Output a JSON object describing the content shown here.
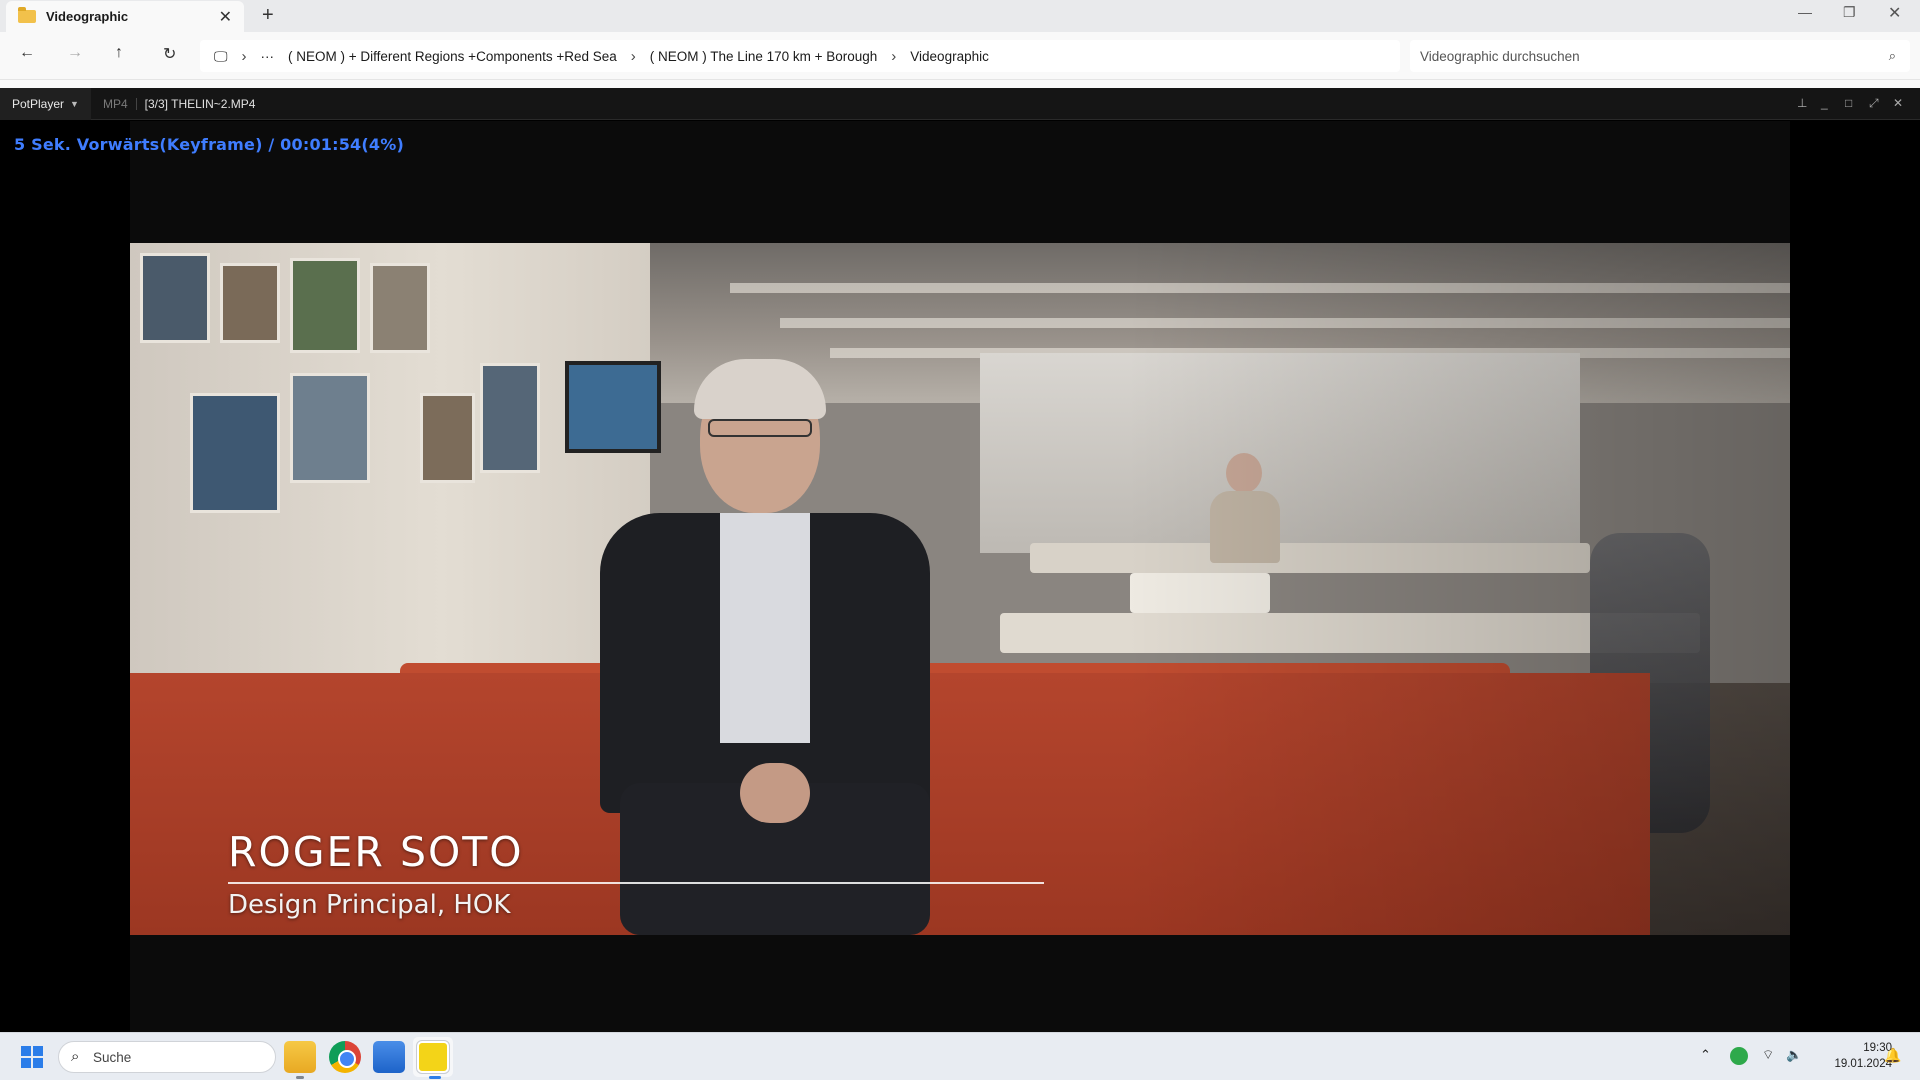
{
  "explorer": {
    "tab_title": "Videographic",
    "tab_close": "✕",
    "new_tab": "+",
    "breadcrumbs": [
      "( NEOM ) + Different Regions +Components +Red Sea",
      "( NEOM ) The Line 170 km + Borough",
      "Videographic"
    ],
    "more_dots": "···",
    "search_placeholder": "Videographic durchsuchen"
  },
  "player": {
    "brand": "PotPlayer",
    "format": "MP4",
    "file": "[3/3] THELIN~2.MP4",
    "osd": "5  Sek. Vorwärts(Keyframe) / 00:01:54(4%)",
    "progress_percent": 4,
    "lower_third": {
      "name": "ROGER SOTO",
      "role": "Design Principal, HOK"
    }
  },
  "taskbar": {
    "search_label": "Suche",
    "time": "19:30",
    "date": "19.01.2024"
  },
  "colors": {
    "osd": "#3f7dff",
    "accent": "#2b7de9"
  },
  "icons": [
    "folder-icon",
    "back-icon",
    "forward-icon",
    "up-icon",
    "refresh-icon",
    "monitor-icon",
    "chevron-right-icon",
    "search-icon",
    "windows-icon",
    "file-explorer-icon",
    "chrome-icon",
    "store-icon",
    "potplayer-icon",
    "wifi-icon",
    "volume-icon",
    "bell-icon"
  ]
}
